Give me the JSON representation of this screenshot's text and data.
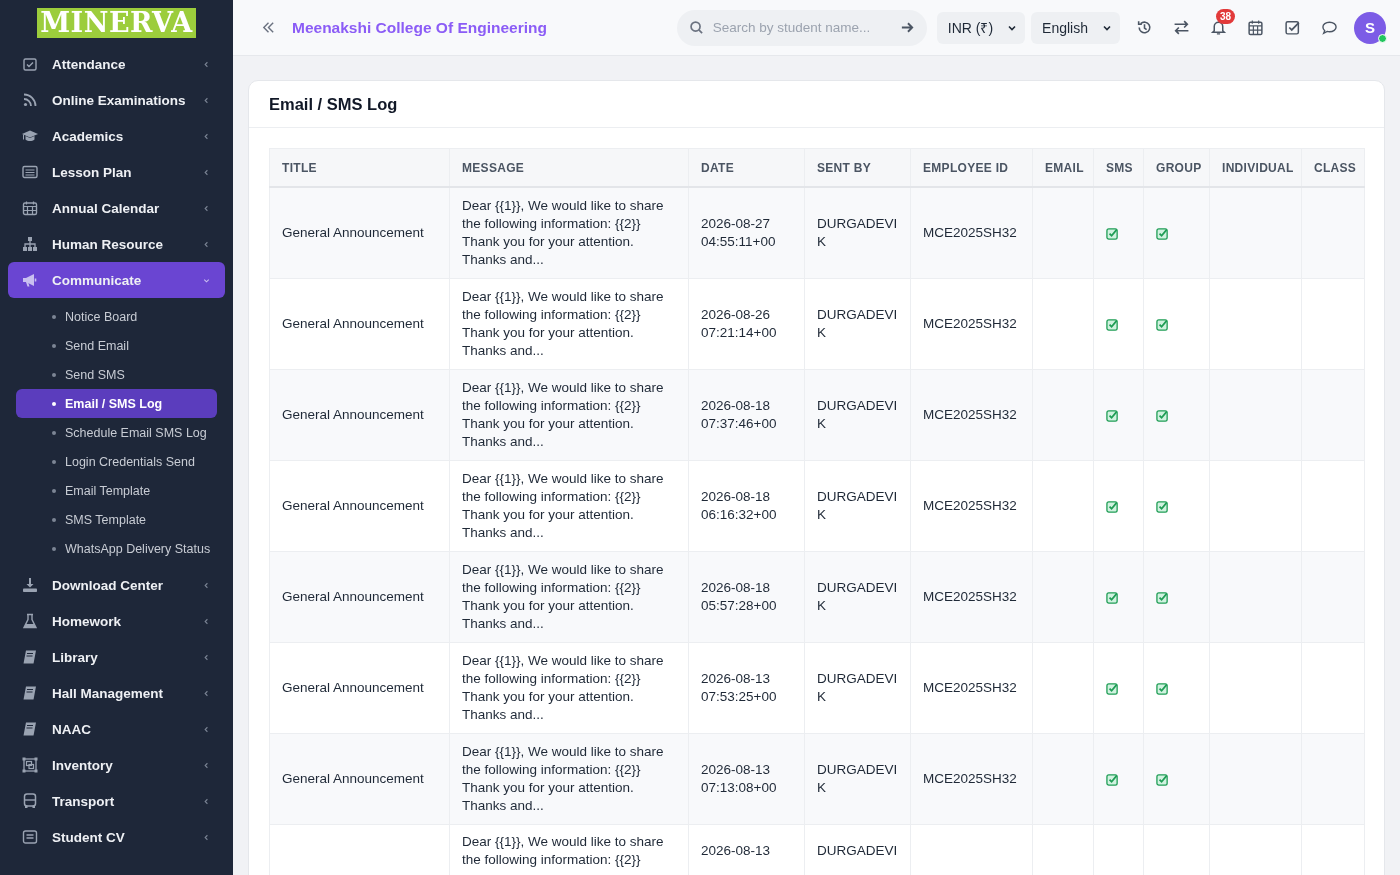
{
  "logo": "MINERVA",
  "sidebar": {
    "items": [
      {
        "label": "Attendance",
        "expanded": false
      },
      {
        "label": "Online Examinations",
        "expanded": false
      },
      {
        "label": "Academics",
        "expanded": false
      },
      {
        "label": "Lesson Plan",
        "expanded": false
      },
      {
        "label": "Annual Calendar",
        "expanded": false
      },
      {
        "label": "Human Resource",
        "expanded": false
      },
      {
        "label": "Communicate",
        "expanded": true,
        "children": [
          {
            "label": "Notice Board",
            "selected": false
          },
          {
            "label": "Send Email",
            "selected": false
          },
          {
            "label": "Send SMS",
            "selected": false
          },
          {
            "label": "Email / SMS Log",
            "selected": true
          },
          {
            "label": "Schedule Email SMS Log",
            "selected": false
          },
          {
            "label": "Login Credentials Send",
            "selected": false
          },
          {
            "label": "Email Template",
            "selected": false
          },
          {
            "label": "SMS Template",
            "selected": false
          },
          {
            "label": "WhatsApp Delivery Status",
            "selected": false
          }
        ]
      },
      {
        "label": "Download Center",
        "expanded": false
      },
      {
        "label": "Homework",
        "expanded": false
      },
      {
        "label": "Library",
        "expanded": false
      },
      {
        "label": "Hall Management",
        "expanded": false
      },
      {
        "label": "NAAC",
        "expanded": false
      },
      {
        "label": "Inventory",
        "expanded": false
      },
      {
        "label": "Transport",
        "expanded": false
      },
      {
        "label": "Student CV",
        "expanded": false
      }
    ]
  },
  "header": {
    "title": "Meenakshi College Of Engineering",
    "search": {
      "placeholder": "Search by student name..."
    },
    "currency": "INR (₹)",
    "language": "English",
    "notification_count": "38",
    "avatar": "S"
  },
  "card": {
    "title": "Email / SMS Log"
  },
  "table": {
    "columns": [
      "TITLE",
      "MESSAGE",
      "DATE",
      "SENT BY",
      "EMPLOYEE ID",
      "EMAIL",
      "SMS",
      "GROUP",
      "INDIVIDUAL",
      "CLASS"
    ],
    "rows": [
      {
        "title": "General Announcement",
        "message": "Dear {{1}}, We would like to share\nthe following information: {{2}}\nThank you for your attention.\nThanks and...",
        "date": "2026-08-27 04:55:11+00",
        "sent_by": "DURGADEVI K",
        "employee_id": "MCE2025SH32",
        "email": false,
        "sms": true,
        "group": true,
        "individual": false,
        "class": false
      },
      {
        "title": "General Announcement",
        "message": "Dear {{1}}, We would like to share\nthe following information: {{2}}\nThank you for your attention.\nThanks and...",
        "date": "2026-08-26 07:21:14+00",
        "sent_by": "DURGADEVI K",
        "employee_id": "MCE2025SH32",
        "email": false,
        "sms": true,
        "group": true,
        "individual": false,
        "class": false
      },
      {
        "title": "General Announcement",
        "message": "Dear {{1}}, We would like to share\nthe following information: {{2}}\nThank you for your attention.\nThanks and...",
        "date": "2026-08-18 07:37:46+00",
        "sent_by": "DURGADEVI K",
        "employee_id": "MCE2025SH32",
        "email": false,
        "sms": true,
        "group": true,
        "individual": false,
        "class": false
      },
      {
        "title": "General Announcement",
        "message": "Dear {{1}}, We would like to share\nthe following information: {{2}}\nThank you for your attention.\nThanks and...",
        "date": "2026-08-18 06:16:32+00",
        "sent_by": "DURGADEVI K",
        "employee_id": "MCE2025SH32",
        "email": false,
        "sms": true,
        "group": true,
        "individual": false,
        "class": false
      },
      {
        "title": "General Announcement",
        "message": "Dear {{1}}, We would like to share\nthe following information: {{2}}\nThank you for your attention.\nThanks and...",
        "date": "2026-08-18 05:57:28+00",
        "sent_by": "DURGADEVI K",
        "employee_id": "MCE2025SH32",
        "email": false,
        "sms": true,
        "group": true,
        "individual": false,
        "class": false
      },
      {
        "title": "General Announcement",
        "message": "Dear {{1}}, We would like to share\nthe following information: {{2}}\nThank you for your attention.\nThanks and...",
        "date": "2026-08-13 07:53:25+00",
        "sent_by": "DURGADEVI K",
        "employee_id": "MCE2025SH32",
        "email": false,
        "sms": true,
        "group": true,
        "individual": false,
        "class": false
      },
      {
        "title": "General Announcement",
        "message": "Dear {{1}}, We would like to share\nthe following information: {{2}}\nThank you for your attention.\nThanks and...",
        "date": "2026-08-13 07:13:08+00",
        "sent_by": "DURGADEVI K",
        "employee_id": "MCE2025SH32",
        "email": false,
        "sms": true,
        "group": true,
        "individual": false,
        "class": false
      },
      {
        "message": "Dear {{1}}, We would like to share\nthe following information: {{2}}",
        "date": "2026-08-13",
        "sent_by": "DURGADEVI"
      }
    ]
  }
}
